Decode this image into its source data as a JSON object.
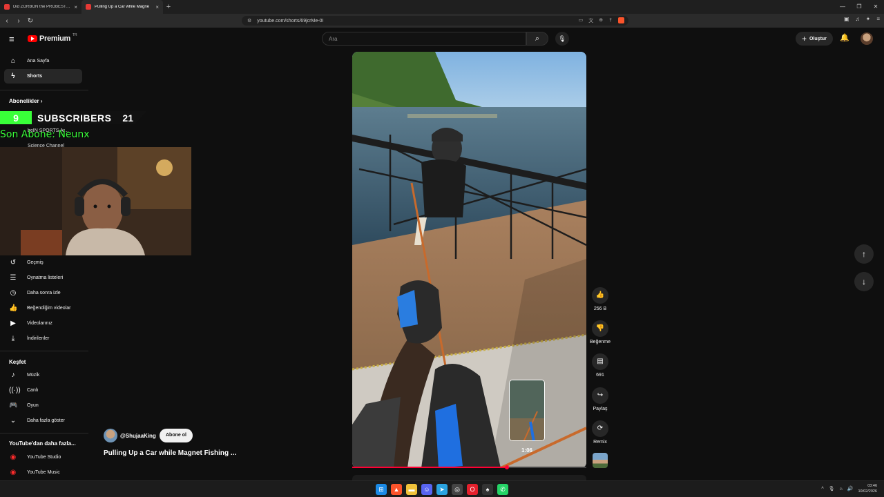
{
  "browser": {
    "tabs": [
      {
        "title": "Did ZORBON the PROBESTER Get the",
        "active": false
      },
      {
        "title": "Pulling Up a Car while Magne",
        "active": true
      }
    ],
    "url": "youtube.com/shorts/69jcrMe-0I"
  },
  "header": {
    "logo": "Premium",
    "logo_tr": "TR",
    "search_placeholder": "Ara",
    "create_label": "Oluştur"
  },
  "sidebar": {
    "main": [
      {
        "label": "Ana Sayfa",
        "icon": "home-icon"
      },
      {
        "label": "Shorts",
        "icon": "shorts-icon",
        "active": true
      }
    ],
    "subscriptions_title": "Abonelikler",
    "subscriptions": [
      {
        "label": "beIN SPORTS Ar..."
      },
      {
        "label": "Science Channel"
      }
    ],
    "you": [
      {
        "label": "Geçmiş",
        "icon": "history-icon"
      },
      {
        "label": "Oynatma listeleri",
        "icon": "playlists-icon"
      },
      {
        "label": "Daha sonra izle",
        "icon": "watch-later-icon"
      },
      {
        "label": "Beğendiğim videolar",
        "icon": "liked-icon"
      },
      {
        "label": "Videolarınız",
        "icon": "your-videos-icon"
      },
      {
        "label": "İndirilenler",
        "icon": "downloads-icon"
      }
    ],
    "explore_title": "Keşfet",
    "explore": [
      {
        "label": "Müzik",
        "icon": "music-icon"
      },
      {
        "label": "Canlı",
        "icon": "live-icon"
      },
      {
        "label": "Oyun",
        "icon": "gaming-icon"
      },
      {
        "label": "Daha fazla göster",
        "icon": "chevron-down-icon"
      }
    ],
    "more_title": "YouTube'dan daha fazla...",
    "more": [
      {
        "label": "YouTube Studio",
        "icon": "youtube-studio-icon"
      },
      {
        "label": "YouTube Music",
        "icon": "youtube-music-icon"
      }
    ]
  },
  "overlay": {
    "subs_left": "9",
    "subs_label": "SUBSCRIBERS",
    "subs_right": "21",
    "last_sub": "Son Abone: Neunx"
  },
  "short": {
    "channel": "@ShujaaKing",
    "subscribe_label": "Abone ol",
    "title": "Pulling Up a Car while Magnet Fishing ...",
    "preview_time": "1:06",
    "progress": 0.66
  },
  "actions": {
    "like_count": "256 B",
    "dislike_label": "Beğenme",
    "comments_count": "691",
    "share_label": "Paylaş",
    "remix_label": "Remix"
  },
  "taskbar": {
    "time": "03:46",
    "date": "10/02/2026"
  },
  "colors": {
    "youtube_red": "#ff0000",
    "progress_red": "#ff0033",
    "overlay_green": "#39ff39"
  }
}
